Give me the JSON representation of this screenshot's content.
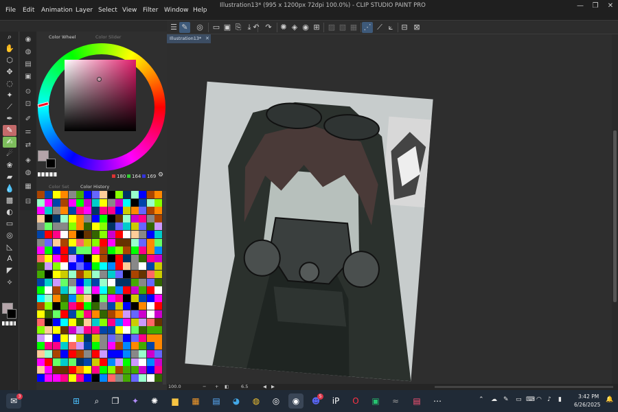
{
  "window": {
    "title": "Illustration13* (995 x 1200px 72dpi 100.0%) - CLIP STUDIO PAINT PRO"
  },
  "menu": [
    "File",
    "Edit",
    "Animation",
    "Layer",
    "Select",
    "View",
    "Filter",
    "Window",
    "Help"
  ],
  "color_panel": {
    "tabs": [
      "Color Wheel",
      "Color Slider"
    ],
    "rgb": {
      "r": "180",
      "g": "164",
      "b": "169"
    },
    "main_color": "#b4a4a9",
    "sub_color": "#000000",
    "hue_color": "#e01c6a"
  },
  "color_set_panel": {
    "tabs": [
      "Color Set",
      "Color History"
    ]
  },
  "document": {
    "tab_label": "Illustration13*"
  },
  "status": {
    "zoom": "100.0",
    "rotation": "6.5"
  },
  "taskbar": {
    "time": "3:42 PM",
    "date": "6/26/2025",
    "mail_badge": "3"
  }
}
